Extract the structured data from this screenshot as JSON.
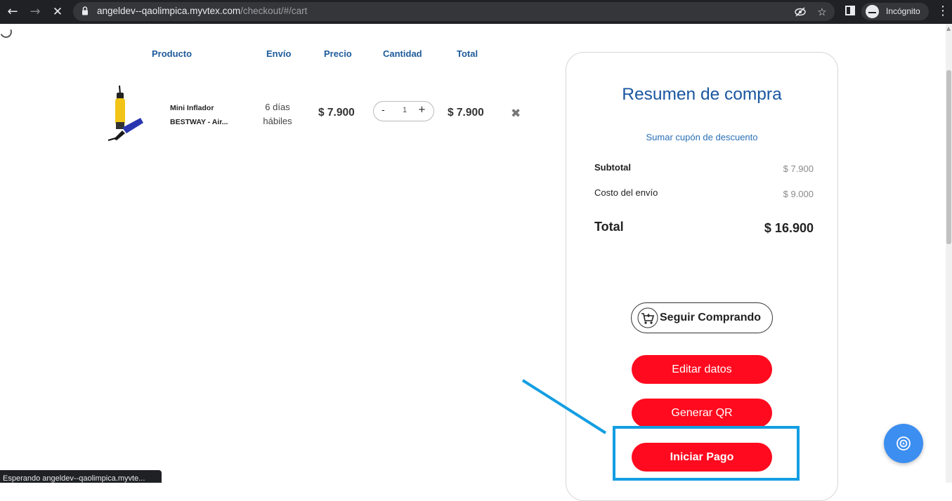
{
  "browser": {
    "url_host": "angeldev--qaolimpica.myvtex.com",
    "url_path": "/checkout/#/cart",
    "profile_label": "Incógnito",
    "status_text": "Esperando angeldev--qaolimpica.myvte..."
  },
  "cart": {
    "headers": {
      "producto": "Producto",
      "envio": "Envío",
      "precio": "Precio",
      "cantidad": "Cantidad",
      "total": "Total"
    },
    "items": [
      {
        "name_line1": "Mini Inflador",
        "name_line2": "BESTWAY - Air...",
        "envio_line1": "6 días",
        "envio_line2": "hábiles",
        "precio": "$ 7.900",
        "qty_minus": "-",
        "quantity": "1",
        "qty_plus": "+",
        "total": "$ 7.900",
        "remove_glyph": "✖"
      }
    ]
  },
  "summary": {
    "title": "Resumen de compra",
    "coupon_link": "Sumar cupón de descuento",
    "subtotal_label": "Subtotal",
    "subtotal_value": "$ 7.900",
    "shipping_label": "Costo del envío",
    "shipping_value": "$ 9.000",
    "total_label": "Total",
    "total_value": "$ 16.900",
    "buttons": {
      "seguir": "Seguir Comprando",
      "editar": "Editar datos",
      "qr": "Generar QR",
      "pagar": "Iniciar Pago"
    }
  },
  "colors": {
    "brand_blue": "#1a56a0",
    "cta_red": "#ff0a1e",
    "annotation": "#139ee2",
    "fab": "#3c8ef0"
  },
  "icons": [
    "back-icon",
    "forward-icon",
    "stop-icon",
    "lock-icon",
    "eye-off-icon",
    "star-icon",
    "side-panel-icon",
    "incognito-icon",
    "menu-icon",
    "cart-icon",
    "remove-icon",
    "fab-icon"
  ]
}
